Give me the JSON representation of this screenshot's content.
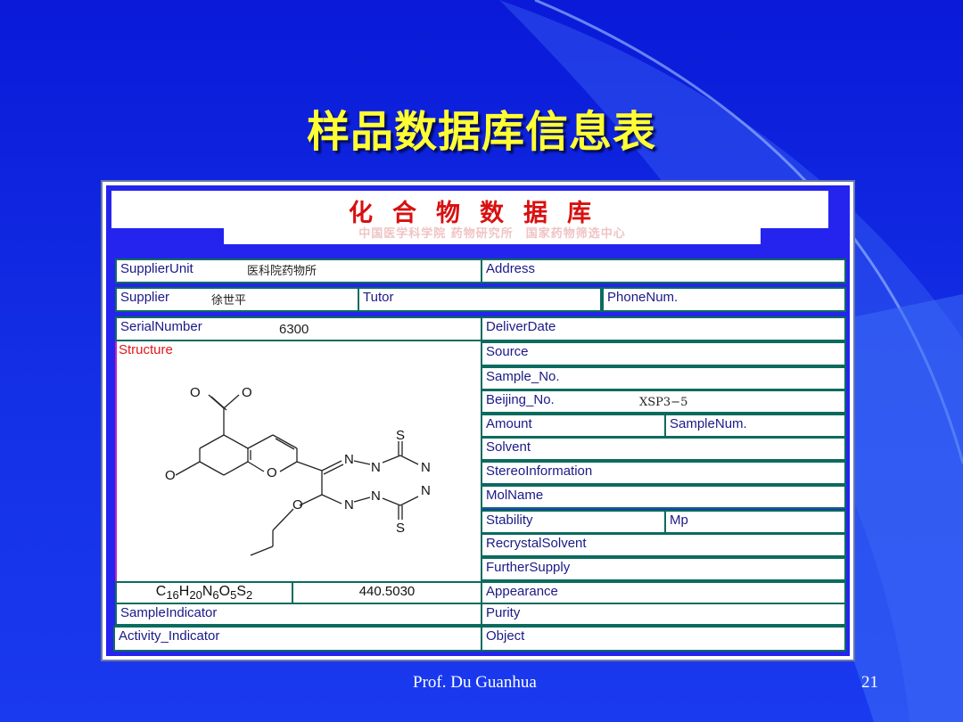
{
  "slide": {
    "title": "样品数据库信息表",
    "author": "Prof. Du Guanhua",
    "page_number": "21"
  },
  "card": {
    "header_title": "化合物数据库",
    "subtitle": "中国医学科学院 药物研究所　国家药物筛选中心",
    "labels": {
      "supplier_unit": "SupplierUnit",
      "address": "Address",
      "supplier": "Supplier",
      "tutor": "Tutor",
      "phone_num": "PhoneNum.",
      "serial_number": "SerialNumber",
      "deliver_date": "DeliverDate",
      "structure": "Structure",
      "source": "Source",
      "sample_no": "Sample_No.",
      "beijing_no": "Beijing_No.",
      "amount": "Amount",
      "sample_num": "SampleNum.",
      "solvent": "Solvent",
      "stereo_information": "StereoInformation",
      "mol_name": "MolName",
      "stability": "Stability",
      "mp": "Mp",
      "recrystal_solvent": "RecrystalSolvent",
      "further_supply": "FurtherSupply",
      "appearance": "Appearance",
      "sample_indicator": "SampleIndicator",
      "purity": "Purity",
      "activity_indicator": "Activity_Indicator",
      "object": "Object"
    },
    "values": {
      "supplier_unit": "医科院药物所",
      "supplier": "徐世平",
      "serial_number": "6300",
      "beijing_no": "XSP3−5",
      "molecular_weight": "440.5030"
    },
    "formula": {
      "c": "C",
      "c_n": "16",
      "h": "H",
      "h_n": "20",
      "n": "N",
      "n_n": "6",
      "o": "O",
      "o_n": "5",
      "s": "S",
      "s_n": "2"
    },
    "structure_atoms": {
      "o": "O",
      "n": "N",
      "s": "S"
    }
  }
}
